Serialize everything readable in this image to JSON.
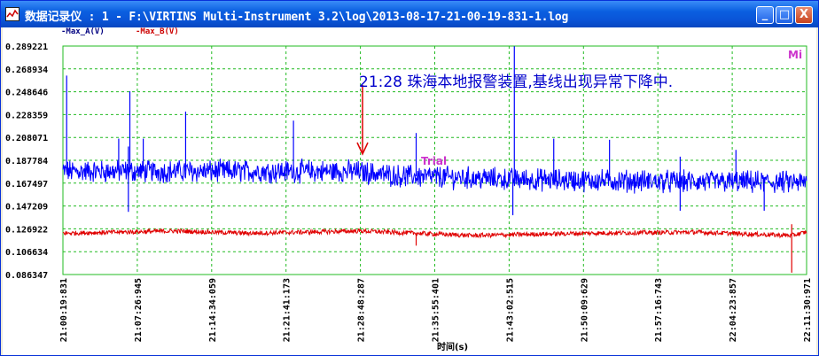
{
  "window": {
    "title": "数据记录仪 : 1 - F:\\VIRTINS Multi-Instrument 3.2\\log\\2013-08-17-21-00-19-831-1.log",
    "buttons": {
      "minimize": "_",
      "maximize": "□",
      "close": "X"
    }
  },
  "legend": [
    {
      "label": "-Max_A(V)",
      "color": "#000080"
    },
    {
      "label": "-Max_B(V)",
      "color": "#cc0000"
    }
  ],
  "corner_label": "Mi",
  "annotation": "21:28 珠海本地报警装置,基线出现异常下降中.",
  "trial_label": "Trial",
  "colors": {
    "series_a": "#0000ff",
    "series_b": "#e00000",
    "grid": "#22bb22",
    "annotation": "#0000cc",
    "arrow": "#dd0000",
    "trial": "#cc33cc"
  },
  "chart_data": {
    "type": "line",
    "xlabel": "时间(s)",
    "x_ticks": [
      "21:00:19:831",
      "21:07:26:945",
      "21:14:34:059",
      "21:21:41:173",
      "21:28:48:287",
      "21:35:55:401",
      "21:43:02:515",
      "21:50:09:629",
      "21:57:16:743",
      "22:04:23:857",
      "22:11:30:971"
    ],
    "y_ticks": [
      "0.289221",
      "0.268934",
      "0.248646",
      "0.228359",
      "0.208071",
      "0.187784",
      "0.167497",
      "0.147209",
      "0.126922",
      "0.106634",
      "0.086347"
    ],
    "ylim": [
      0.086347,
      0.289221
    ],
    "grid": true,
    "series": [
      {
        "name": "Max_A(V)",
        "baseline": [
          {
            "t": 0,
            "v": 0.178
          },
          {
            "t": 0.39,
            "v": 0.178
          },
          {
            "t": 0.45,
            "v": 0.174
          },
          {
            "t": 0.6,
            "v": 0.171
          },
          {
            "t": 0.8,
            "v": 0.169
          },
          {
            "t": 1.0,
            "v": 0.168
          }
        ],
        "spikes": [
          {
            "t": 0.005,
            "v": 0.263
          },
          {
            "t": 0.09,
            "v": 0.249
          },
          {
            "t": 0.088,
            "v": 0.2
          },
          {
            "t": 0.075,
            "v": 0.207
          },
          {
            "t": 0.108,
            "v": 0.207
          },
          {
            "t": 0.165,
            "v": 0.231
          },
          {
            "t": 0.31,
            "v": 0.223
          },
          {
            "t": 0.475,
            "v": 0.212
          },
          {
            "t": 0.607,
            "v": 0.289
          },
          {
            "t": 0.66,
            "v": 0.207
          },
          {
            "t": 0.735,
            "v": 0.206
          },
          {
            "t": 0.83,
            "v": 0.191
          },
          {
            "t": 0.905,
            "v": 0.197
          },
          {
            "t": 0.088,
            "v": 0.142
          },
          {
            "t": 0.605,
            "v": 0.139
          },
          {
            "t": 0.83,
            "v": 0.143
          },
          {
            "t": 0.943,
            "v": 0.143
          }
        ]
      },
      {
        "name": "Max_B(V)",
        "baseline": [
          {
            "t": 0,
            "v": 0.123
          },
          {
            "t": 0.15,
            "v": 0.125
          },
          {
            "t": 0.25,
            "v": 0.123
          },
          {
            "t": 0.4,
            "v": 0.125
          },
          {
            "t": 0.55,
            "v": 0.121
          },
          {
            "t": 0.7,
            "v": 0.123
          },
          {
            "t": 0.85,
            "v": 0.124
          },
          {
            "t": 0.98,
            "v": 0.121
          },
          {
            "t": 1.0,
            "v": 0.124
          }
        ],
        "spikes": [
          {
            "t": 0.98,
            "v": 0.088
          },
          {
            "t": 0.98,
            "v": 0.131
          },
          {
            "t": 0.475,
            "v": 0.112
          }
        ]
      }
    ]
  }
}
